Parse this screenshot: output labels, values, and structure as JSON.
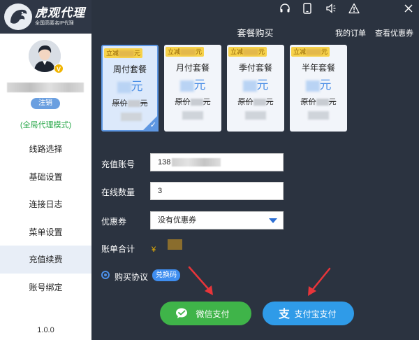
{
  "brand": {
    "title": "虎观代理",
    "subtitle": "全国高匿名IP代理"
  },
  "user": {
    "vip_badge": "V",
    "logout_label": "注销",
    "mode": "(全局代理模式)"
  },
  "sidebar": {
    "items": [
      {
        "label": "线路选择"
      },
      {
        "label": "基础设置"
      },
      {
        "label": "连接日志"
      },
      {
        "label": "菜单设置"
      },
      {
        "label": "充值续费",
        "active": true
      },
      {
        "label": "账号绑定"
      }
    ],
    "version": "1.0.0"
  },
  "topbar": {
    "icons": [
      "headset-icon",
      "phone-icon",
      "volume-icon",
      "warning-icon",
      "close-icon"
    ]
  },
  "page": {
    "title": "套餐购买",
    "my_orders": "我的订单",
    "view_coupons": "查看优惠券"
  },
  "plans": [
    {
      "discount": "立减",
      "name": "周付套餐",
      "price_unit": "元",
      "orig_prefix": "原价",
      "orig_unit": "元",
      "selected": true
    },
    {
      "discount": "立减",
      "name": "月付套餐",
      "price_unit": "元",
      "orig_prefix": "原价",
      "orig_unit": "元",
      "selected": false
    },
    {
      "discount": "立减",
      "name": "季付套餐",
      "price_unit": "元",
      "orig_prefix": "原价",
      "orig_unit": "元",
      "selected": false
    },
    {
      "discount": "立减",
      "name": "半年套餐",
      "price_unit": "元",
      "orig_prefix": "原价",
      "orig_unit": "元",
      "selected": false
    }
  ],
  "form": {
    "account_label": "充值账号",
    "account_value": "138",
    "quantity_label": "在线数量",
    "quantity_value": "3",
    "coupon_label": "优惠券",
    "coupon_value": "没有优惠券",
    "total_label": "账单合计",
    "currency": "¥"
  },
  "agreement": {
    "label": "购买协议",
    "redeem_label": "兑换码"
  },
  "payment": {
    "wechat_label": "微信支付",
    "alipay_label": "支付宝支付"
  },
  "colors": {
    "dark_bg": "#2b3340",
    "accent_blue": "#4c8fe6",
    "wechat_green": "#3fb449",
    "alipay_blue": "#2f9be8",
    "discount_yellow": "#f7d24a",
    "arrow_red": "#e8353a"
  }
}
